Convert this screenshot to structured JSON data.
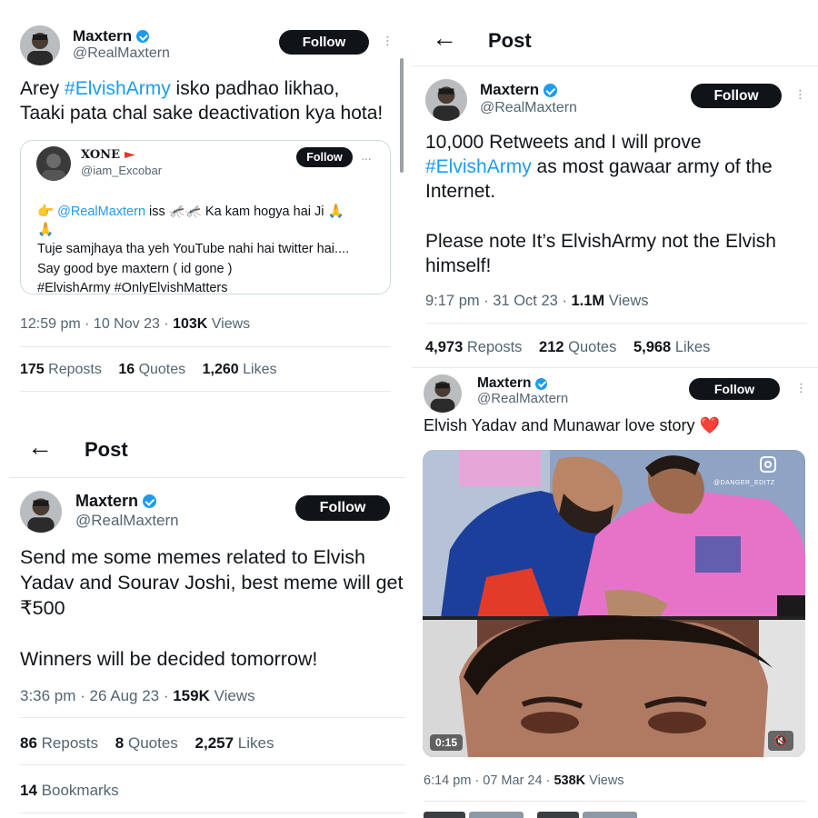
{
  "tweet1": {
    "name": "Maxtern",
    "handle": "@RealMaxtern",
    "follow_label": "Follow",
    "text_part1": "Arey ",
    "hashtag": "#ElvishArmy",
    "text_part2": " isko padhao likhao,",
    "text_line2": "Taaki pata chal sake deactivation kya hota!",
    "quote": {
      "name": "XONE",
      "handle": "@iam_Excobar",
      "follow_label": "Follow",
      "line1_mention": "@RealMaxtern",
      "line1_rest": " iss 🦟🦟 Ka kam hogya hai Ji 🙏",
      "line1b": "🙏",
      "line2": "Tuje samjhaya tha yeh YouTube nahi hai twitter hai....",
      "line3": "Say good bye maxtern ( id gone )",
      "line4": "#ElvishArmy #OnlyElvishMatters"
    },
    "time_date": "12:59 pm · 10 Nov 23 · ",
    "views_count": "103K",
    "views_label": " Views",
    "reposts_count": "175",
    "reposts_label": "Reposts",
    "quotes_count": "16",
    "quotes_label": "Quotes",
    "likes_count": "1,260",
    "likes_label": "Likes"
  },
  "tweet2": {
    "header_title": "Post",
    "name": "Maxtern",
    "handle": "@RealMaxtern",
    "follow_label": "Follow",
    "line1": "Send me some memes related to Elvish",
    "line2": "Yadav and Sourav Joshi, best meme will get",
    "line3": "₹500",
    "line4": "Winners will be decided tomorrow!",
    "time_date": "3:36 pm · 26 Aug 23 · ",
    "views_count": "159K",
    "views_label": " Views",
    "reposts_count": "86",
    "reposts_label": "Reposts",
    "quotes_count": "8",
    "quotes_label": "Quotes",
    "likes_count": "2,257",
    "likes_label": "Likes",
    "bookmarks_count": "14",
    "bookmarks_label": "Bookmarks"
  },
  "tweet3": {
    "header_title": "Post",
    "name": "Maxtern",
    "handle": "@RealMaxtern",
    "follow_label": "Follow",
    "line1": "10,000 Retweets and I will prove",
    "hashtag": "#ElvishArmy",
    "line2_rest": " as most gawaar army of the",
    "line3": "Internet.",
    "line4": "Please note It’s ElvishArmy not the Elvish",
    "line5": "himself!",
    "time_date": "9:17 pm · 31 Oct 23 · ",
    "views_count": "1.1M",
    "views_label": " Views",
    "reposts_count": "4,973",
    "reposts_label": "Reposts",
    "quotes_count": "212",
    "quotes_label": "Quotes",
    "likes_count": "5,968",
    "likes_label": "Likes"
  },
  "tweet4": {
    "name": "Maxtern",
    "handle": "@RealMaxtern",
    "follow_label": "Follow",
    "text": "Elvish Yadav and Munawar love story ❤️",
    "video_watermark": "@DANGER_EDITZ",
    "video_duration": "0:15",
    "time_date": "6:14 pm · 07 Mar 24 · ",
    "views_count": "538K",
    "views_label": " Views"
  },
  "colors": {
    "accent": "#1d9bf0",
    "text": "#0f1419",
    "muted": "#536471",
    "follow_bg": "#0f1419"
  }
}
